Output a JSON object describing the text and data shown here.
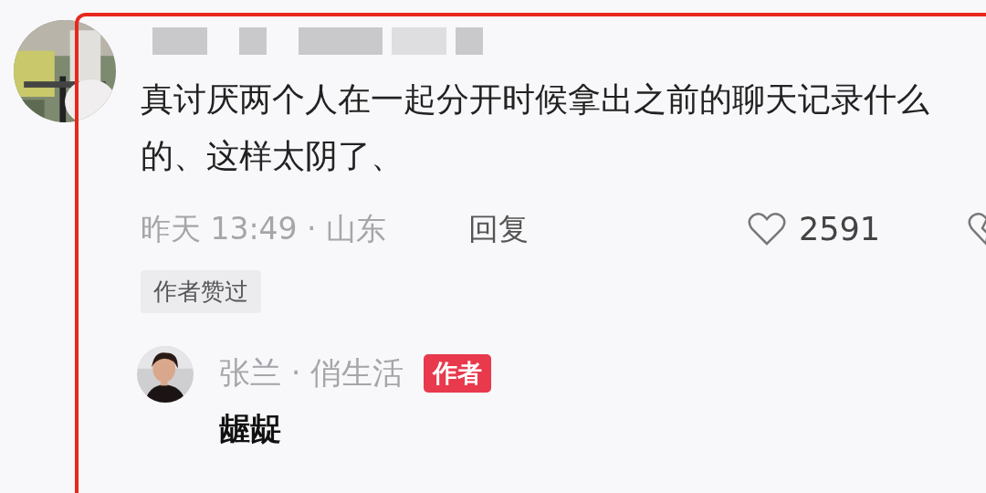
{
  "comment": {
    "text": "真讨厌两个人在一起分开时候拿出之前的聊天记录什么的、这样太阴了、",
    "meta": "昨天 13:49 · 山东",
    "reply_button": "回复",
    "likes": "2591",
    "liked": false,
    "badge": "作者赞过",
    "reply": {
      "name": "张兰 · 俏生活",
      "badge": "作者",
      "text": "龌龊"
    }
  },
  "highlight": {
    "color": "#e8281e"
  }
}
